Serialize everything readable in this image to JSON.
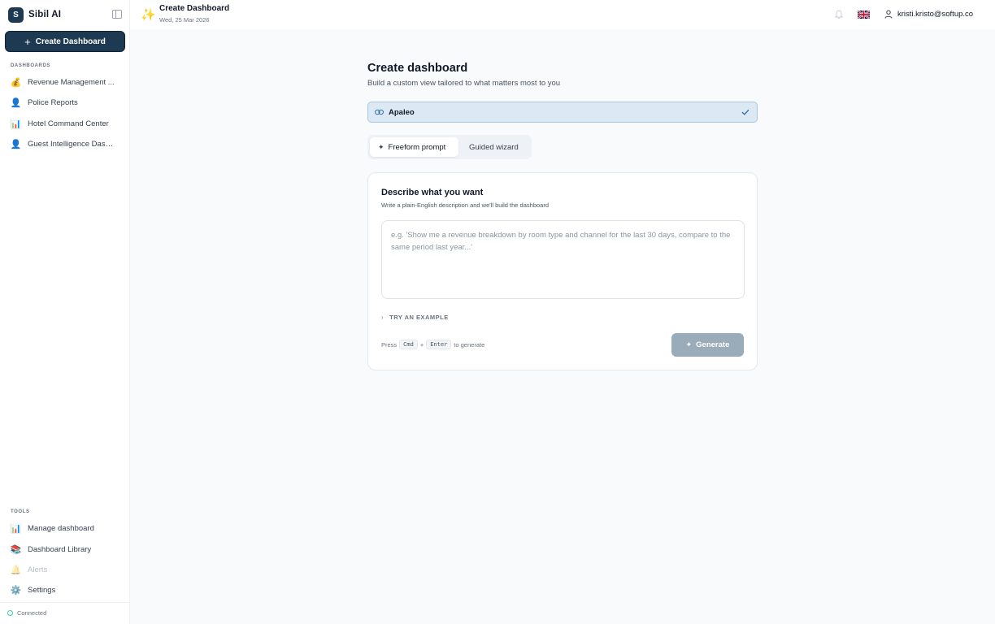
{
  "app": {
    "brand_initial": "S",
    "brand_name": "Sibil AI"
  },
  "sidebar": {
    "create_label": "Create Dashboard",
    "dashboards_label": "DASHBOARDS",
    "dashboards": [
      {
        "emoji": "💰",
        "label": "Revenue Management ..."
      },
      {
        "emoji": "👤",
        "label": "Police Reports"
      },
      {
        "emoji": "📊",
        "label": "Hotel Command Center"
      },
      {
        "emoji": "👤",
        "label": "Guest Intelligence Dash..."
      }
    ],
    "tools_label": "TOOLS",
    "tools": [
      {
        "emoji": "📊",
        "label": "Manage dashboard"
      },
      {
        "emoji": "📚",
        "label": "Dashboard Library"
      },
      {
        "emoji": "🔔",
        "label": "Alerts"
      },
      {
        "emoji": "⚙️",
        "label": "Settings"
      }
    ],
    "status": "Connected"
  },
  "header": {
    "sparkle": "✨",
    "title": "Create Dashboard",
    "date": "Wed, 25 Mar 2026",
    "flag": "🇬🇧",
    "user_email": "kristi.kristo@softup.co"
  },
  "main": {
    "title": "Create dashboard",
    "subtitle": "Build a custom view tailored to what matters most to you",
    "source": "Apaleo",
    "tabs": [
      {
        "label": "Freeform prompt",
        "active": true
      },
      {
        "label": "Guided wizard",
        "active": false
      }
    ],
    "card": {
      "title": "Describe what you want",
      "subtitle": "Write a plain-English description and we'll build the dashboard",
      "placeholder": "e.g. 'Show me a revenue breakdown by room type and channel for the last 30 days, compare to the same period last year...'",
      "value": "",
      "example_label": "TRY AN EXAMPLE",
      "hint_press": "Press",
      "key1": "Cmd",
      "plus": "+",
      "key2": "Enter",
      "hint_tail": "to generate",
      "generate_label": "Generate"
    }
  },
  "colors": {
    "brand": "#1e3a52",
    "source_bg": "#dce9f5",
    "generate_disabled": "#9aabba",
    "connected": "#34d399"
  }
}
